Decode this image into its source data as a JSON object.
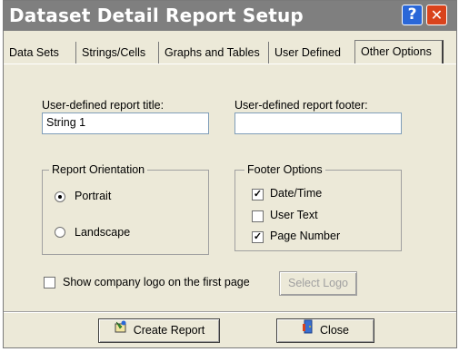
{
  "window": {
    "title": "Dataset Detail Report Setup",
    "help_glyph": "?",
    "close_glyph": "✕",
    "titlebar_color": "#7f7f7f"
  },
  "tabs": [
    {
      "label": "Data Sets",
      "active": false
    },
    {
      "label": "Strings/Cells",
      "active": false
    },
    {
      "label": "Graphs and Tables",
      "active": false
    },
    {
      "label": "User Defined",
      "active": false
    },
    {
      "label": "Other Options",
      "active": true
    }
  ],
  "report_title": {
    "label": "User-defined report title:",
    "value": "String 1"
  },
  "report_footer": {
    "label": "User-defined report footer:",
    "value": ""
  },
  "orientation": {
    "title": "Report Orientation",
    "options": [
      {
        "label": "Portrait",
        "selected": true
      },
      {
        "label": "Landscape",
        "selected": false
      }
    ]
  },
  "footer_options": {
    "title": "Footer Options",
    "items": [
      {
        "label": "Date/Time",
        "checked": true
      },
      {
        "label": "User Text",
        "checked": false
      },
      {
        "label": "Page Number",
        "checked": true
      }
    ]
  },
  "logo": {
    "checkbox_label": "Show company logo on  the first page",
    "checked": false,
    "select_button": "Select Logo"
  },
  "buttons": {
    "create_report": "Create Report",
    "close": "Close",
    "create_icon": "report-wizard-icon",
    "close_icon": "exit-door-icon"
  }
}
